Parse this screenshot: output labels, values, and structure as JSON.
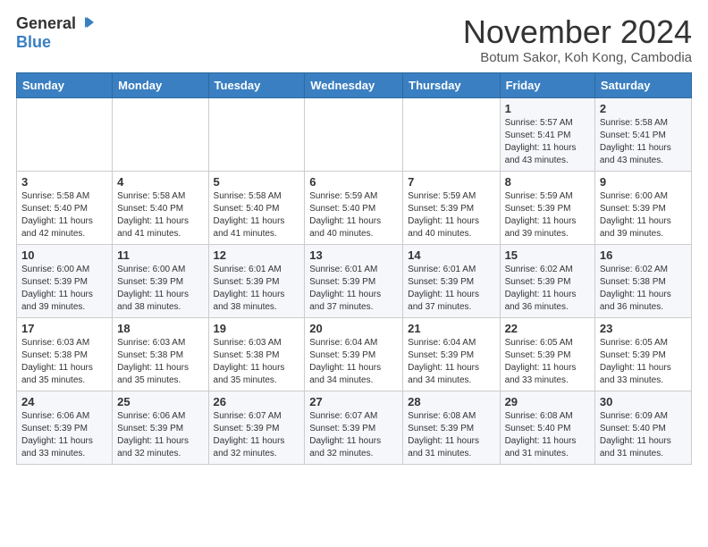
{
  "header": {
    "logo_general": "General",
    "logo_blue": "Blue",
    "month_title": "November 2024",
    "location": "Botum Sakor, Koh Kong, Cambodia"
  },
  "weekdays": [
    "Sunday",
    "Monday",
    "Tuesday",
    "Wednesday",
    "Thursday",
    "Friday",
    "Saturday"
  ],
  "weeks": [
    [
      {
        "day": "",
        "info": ""
      },
      {
        "day": "",
        "info": ""
      },
      {
        "day": "",
        "info": ""
      },
      {
        "day": "",
        "info": ""
      },
      {
        "day": "",
        "info": ""
      },
      {
        "day": "1",
        "info": "Sunrise: 5:57 AM\nSunset: 5:41 PM\nDaylight: 11 hours\nand 43 minutes."
      },
      {
        "day": "2",
        "info": "Sunrise: 5:58 AM\nSunset: 5:41 PM\nDaylight: 11 hours\nand 43 minutes."
      }
    ],
    [
      {
        "day": "3",
        "info": "Sunrise: 5:58 AM\nSunset: 5:40 PM\nDaylight: 11 hours\nand 42 minutes."
      },
      {
        "day": "4",
        "info": "Sunrise: 5:58 AM\nSunset: 5:40 PM\nDaylight: 11 hours\nand 41 minutes."
      },
      {
        "day": "5",
        "info": "Sunrise: 5:58 AM\nSunset: 5:40 PM\nDaylight: 11 hours\nand 41 minutes."
      },
      {
        "day": "6",
        "info": "Sunrise: 5:59 AM\nSunset: 5:40 PM\nDaylight: 11 hours\nand 40 minutes."
      },
      {
        "day": "7",
        "info": "Sunrise: 5:59 AM\nSunset: 5:39 PM\nDaylight: 11 hours\nand 40 minutes."
      },
      {
        "day": "8",
        "info": "Sunrise: 5:59 AM\nSunset: 5:39 PM\nDaylight: 11 hours\nand 39 minutes."
      },
      {
        "day": "9",
        "info": "Sunrise: 6:00 AM\nSunset: 5:39 PM\nDaylight: 11 hours\nand 39 minutes."
      }
    ],
    [
      {
        "day": "10",
        "info": "Sunrise: 6:00 AM\nSunset: 5:39 PM\nDaylight: 11 hours\nand 39 minutes."
      },
      {
        "day": "11",
        "info": "Sunrise: 6:00 AM\nSunset: 5:39 PM\nDaylight: 11 hours\nand 38 minutes."
      },
      {
        "day": "12",
        "info": "Sunrise: 6:01 AM\nSunset: 5:39 PM\nDaylight: 11 hours\nand 38 minutes."
      },
      {
        "day": "13",
        "info": "Sunrise: 6:01 AM\nSunset: 5:39 PM\nDaylight: 11 hours\nand 37 minutes."
      },
      {
        "day": "14",
        "info": "Sunrise: 6:01 AM\nSunset: 5:39 PM\nDaylight: 11 hours\nand 37 minutes."
      },
      {
        "day": "15",
        "info": "Sunrise: 6:02 AM\nSunset: 5:39 PM\nDaylight: 11 hours\nand 36 minutes."
      },
      {
        "day": "16",
        "info": "Sunrise: 6:02 AM\nSunset: 5:38 PM\nDaylight: 11 hours\nand 36 minutes."
      }
    ],
    [
      {
        "day": "17",
        "info": "Sunrise: 6:03 AM\nSunset: 5:38 PM\nDaylight: 11 hours\nand 35 minutes."
      },
      {
        "day": "18",
        "info": "Sunrise: 6:03 AM\nSunset: 5:38 PM\nDaylight: 11 hours\nand 35 minutes."
      },
      {
        "day": "19",
        "info": "Sunrise: 6:03 AM\nSunset: 5:38 PM\nDaylight: 11 hours\nand 35 minutes."
      },
      {
        "day": "20",
        "info": "Sunrise: 6:04 AM\nSunset: 5:39 PM\nDaylight: 11 hours\nand 34 minutes."
      },
      {
        "day": "21",
        "info": "Sunrise: 6:04 AM\nSunset: 5:39 PM\nDaylight: 11 hours\nand 34 minutes."
      },
      {
        "day": "22",
        "info": "Sunrise: 6:05 AM\nSunset: 5:39 PM\nDaylight: 11 hours\nand 33 minutes."
      },
      {
        "day": "23",
        "info": "Sunrise: 6:05 AM\nSunset: 5:39 PM\nDaylight: 11 hours\nand 33 minutes."
      }
    ],
    [
      {
        "day": "24",
        "info": "Sunrise: 6:06 AM\nSunset: 5:39 PM\nDaylight: 11 hours\nand 33 minutes."
      },
      {
        "day": "25",
        "info": "Sunrise: 6:06 AM\nSunset: 5:39 PM\nDaylight: 11 hours\nand 32 minutes."
      },
      {
        "day": "26",
        "info": "Sunrise: 6:07 AM\nSunset: 5:39 PM\nDaylight: 11 hours\nand 32 minutes."
      },
      {
        "day": "27",
        "info": "Sunrise: 6:07 AM\nSunset: 5:39 PM\nDaylight: 11 hours\nand 32 minutes."
      },
      {
        "day": "28",
        "info": "Sunrise: 6:08 AM\nSunset: 5:39 PM\nDaylight: 11 hours\nand 31 minutes."
      },
      {
        "day": "29",
        "info": "Sunrise: 6:08 AM\nSunset: 5:40 PM\nDaylight: 11 hours\nand 31 minutes."
      },
      {
        "day": "30",
        "info": "Sunrise: 6:09 AM\nSunset: 5:40 PM\nDaylight: 11 hours\nand 31 minutes."
      }
    ]
  ]
}
